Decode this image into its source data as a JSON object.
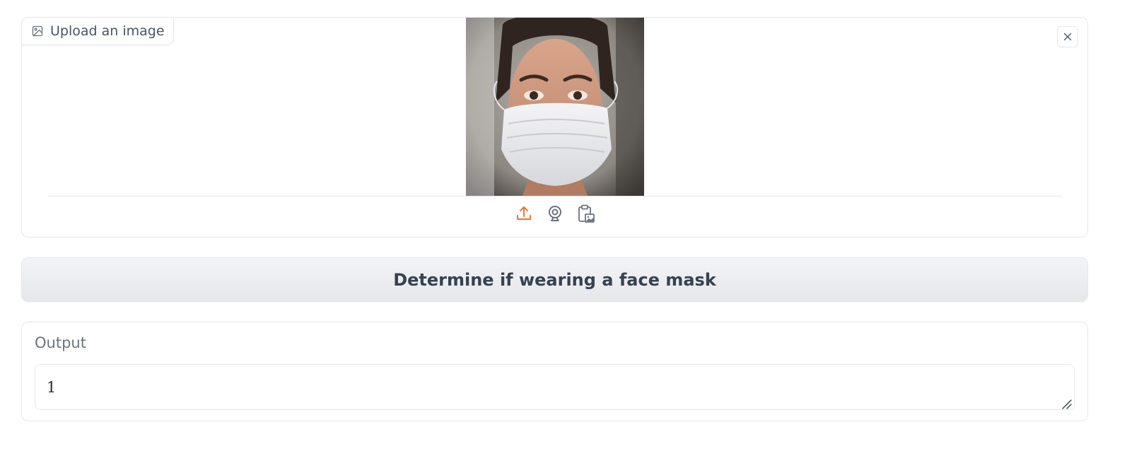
{
  "image_input": {
    "label": "Upload an image",
    "label_icon": "image-icon",
    "close_icon": "close-icon",
    "preview_alt": "Woman wearing a white surgical face mask",
    "sources": [
      {
        "name": "upload-icon",
        "color": "#e8772e"
      },
      {
        "name": "webcam-icon",
        "color": "#6b7280"
      },
      {
        "name": "clipboard-icon",
        "color": "#6b7280"
      }
    ]
  },
  "submit": {
    "label": "Determine if wearing a face mask"
  },
  "output": {
    "label": "Output",
    "value": "1"
  },
  "colors": {
    "accent": "#e8772e",
    "border": "#e5e7eb",
    "text": "#374151"
  }
}
